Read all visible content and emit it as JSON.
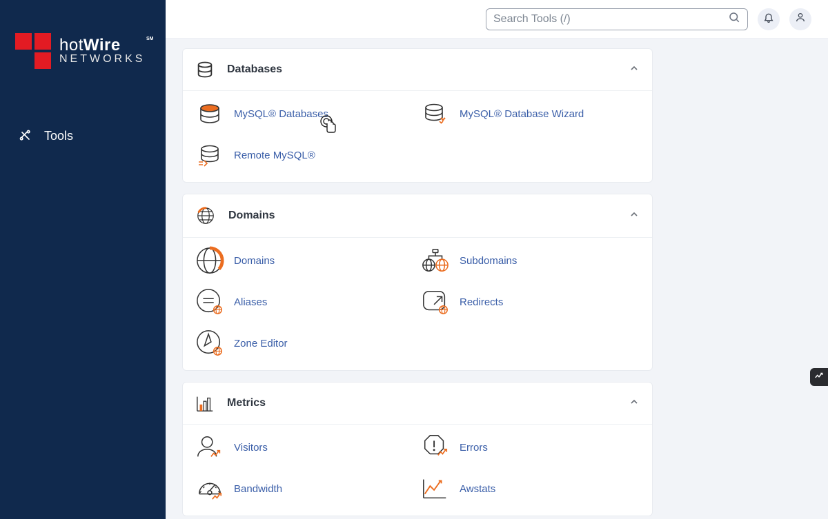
{
  "brand": {
    "name_thin": "hot",
    "name_bold": "Wire",
    "sm": "SM",
    "sub": "NETWORKS"
  },
  "sidebar": {
    "tools_label": "Tools"
  },
  "topbar": {
    "search_placeholder": "Search Tools (/)"
  },
  "panels": {
    "databases": {
      "title": "Databases",
      "items": {
        "mysql_db": "MySQL® Databases",
        "mysql_wizard": "MySQL® Database Wizard",
        "remote_mysql": "Remote MySQL®"
      }
    },
    "domains": {
      "title": "Domains",
      "items": {
        "domains": "Domains",
        "subdomains": "Subdomains",
        "aliases": "Aliases",
        "redirects": "Redirects",
        "zone_editor": "Zone Editor"
      }
    },
    "metrics": {
      "title": "Metrics",
      "items": {
        "visitors": "Visitors",
        "errors": "Errors",
        "bandwidth": "Bandwidth",
        "awstats": "Awstats"
      }
    }
  }
}
